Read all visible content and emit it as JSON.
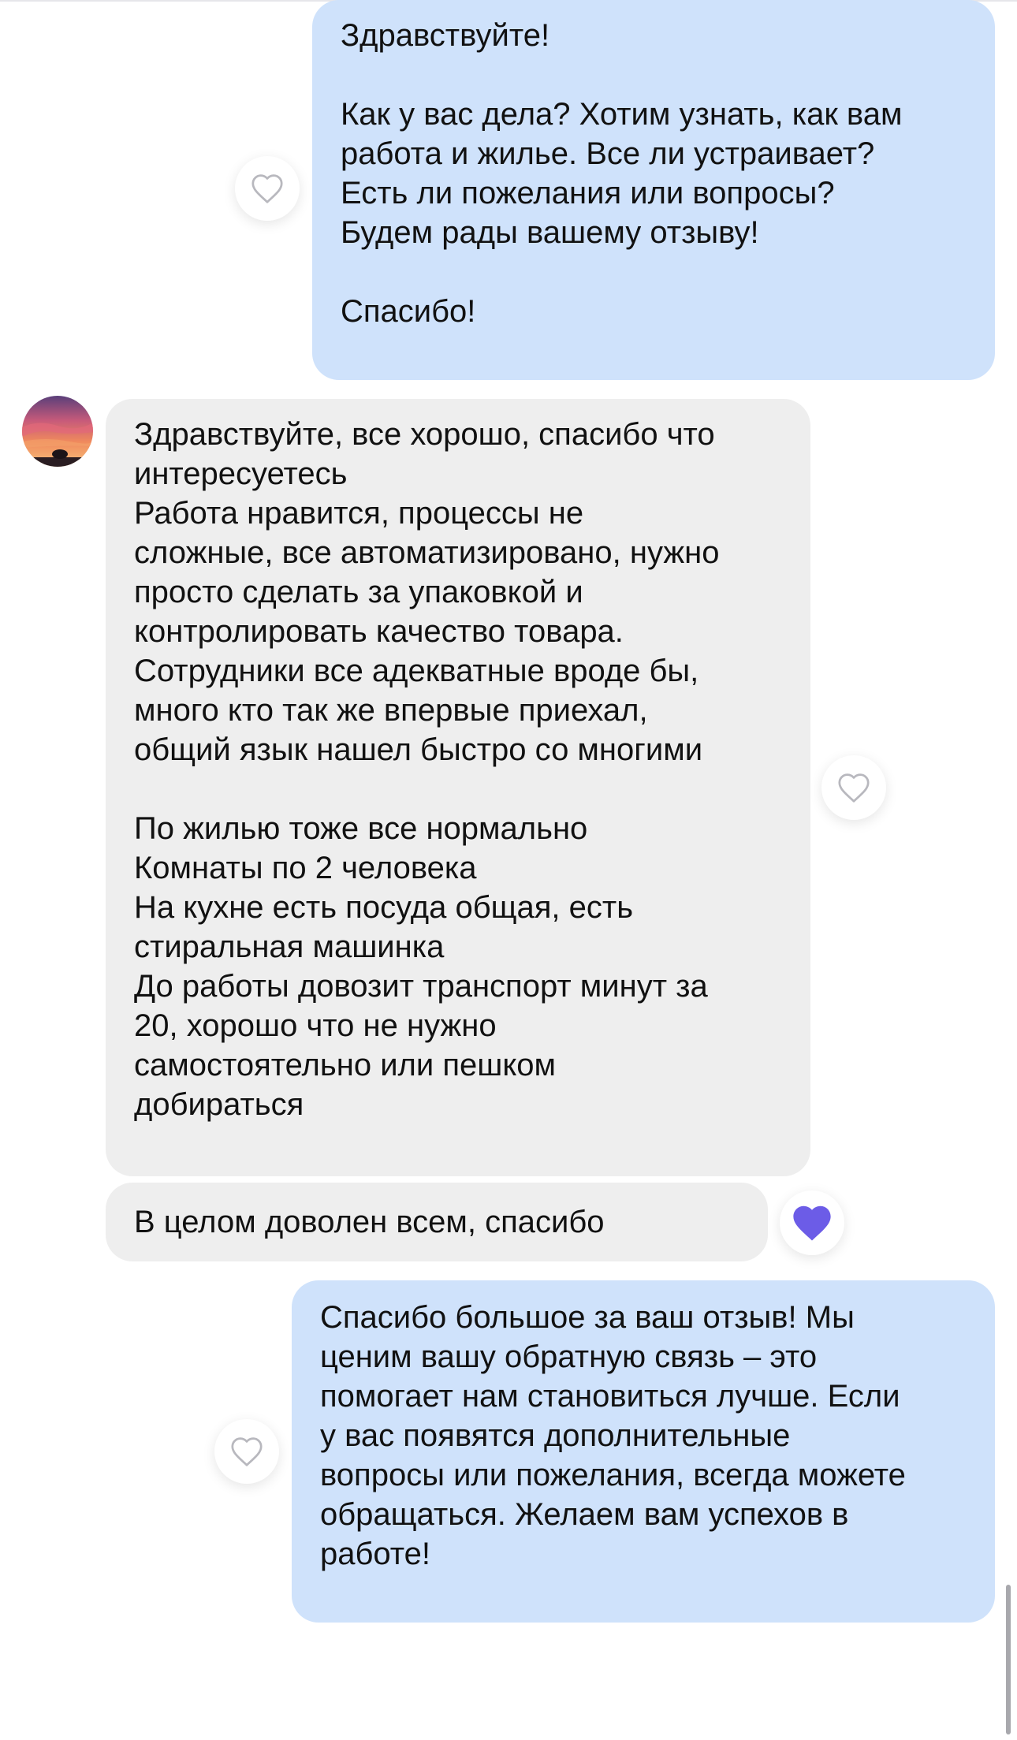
{
  "colors": {
    "outgoing_bubble": "#cfe2fb",
    "incoming_bubble": "#eeeeee",
    "liked_heart": "#6c5ce7",
    "heart_outline": "#b8b8be"
  },
  "messages": [
    {
      "direction": "outgoing",
      "lines": [
        "Здравствуйте!",
        "",
        "Как у вас дела? Хотим узнать, как вам",
        "работа и жилье. Все ли устраивает?",
        "Есть ли пожелания или вопросы?",
        "Будем рады вашему отзыву!",
        "",
        "Спасибо!"
      ],
      "reaction": "heart-outline-icon"
    },
    {
      "direction": "incoming",
      "lines": [
        "Здравствуйте, все хорошо, спасибо что",
        "интересуетесь",
        "Работа нравится, процессы не",
        "сложные, все автоматизировано, нужно",
        "просто сделать за упаковкой и",
        "контролировать качество товара.",
        "Сотрудники все адекватные вроде бы,",
        "много кто так же впервые приехал,",
        "общий язык нашел быстро со многими",
        "",
        "По жилью тоже все нормально",
        "Комнаты по 2 человека",
        "На кухне есть посуда общая, есть",
        "стиральная машинка",
        "До работы довозит транспорт минут за",
        "20, хорошо что не нужно",
        "самостоятельно или пешком",
        "добираться"
      ],
      "reaction": "heart-outline-icon"
    },
    {
      "direction": "incoming",
      "lines": [
        "В целом доволен всем, спасибо"
      ],
      "reaction": "heart-filled-icon"
    },
    {
      "direction": "outgoing",
      "lines": [
        "Спасибо большое за ваш отзыв! Мы",
        "ценим вашу обратную связь – это",
        "помогает нам становиться лучше. Если",
        "у вас появятся дополнительные",
        "вопросы или пожелания, всегда можете",
        "обращаться. Желаем вам успехов в",
        "работе!"
      ],
      "reaction": "heart-outline-icon"
    }
  ]
}
